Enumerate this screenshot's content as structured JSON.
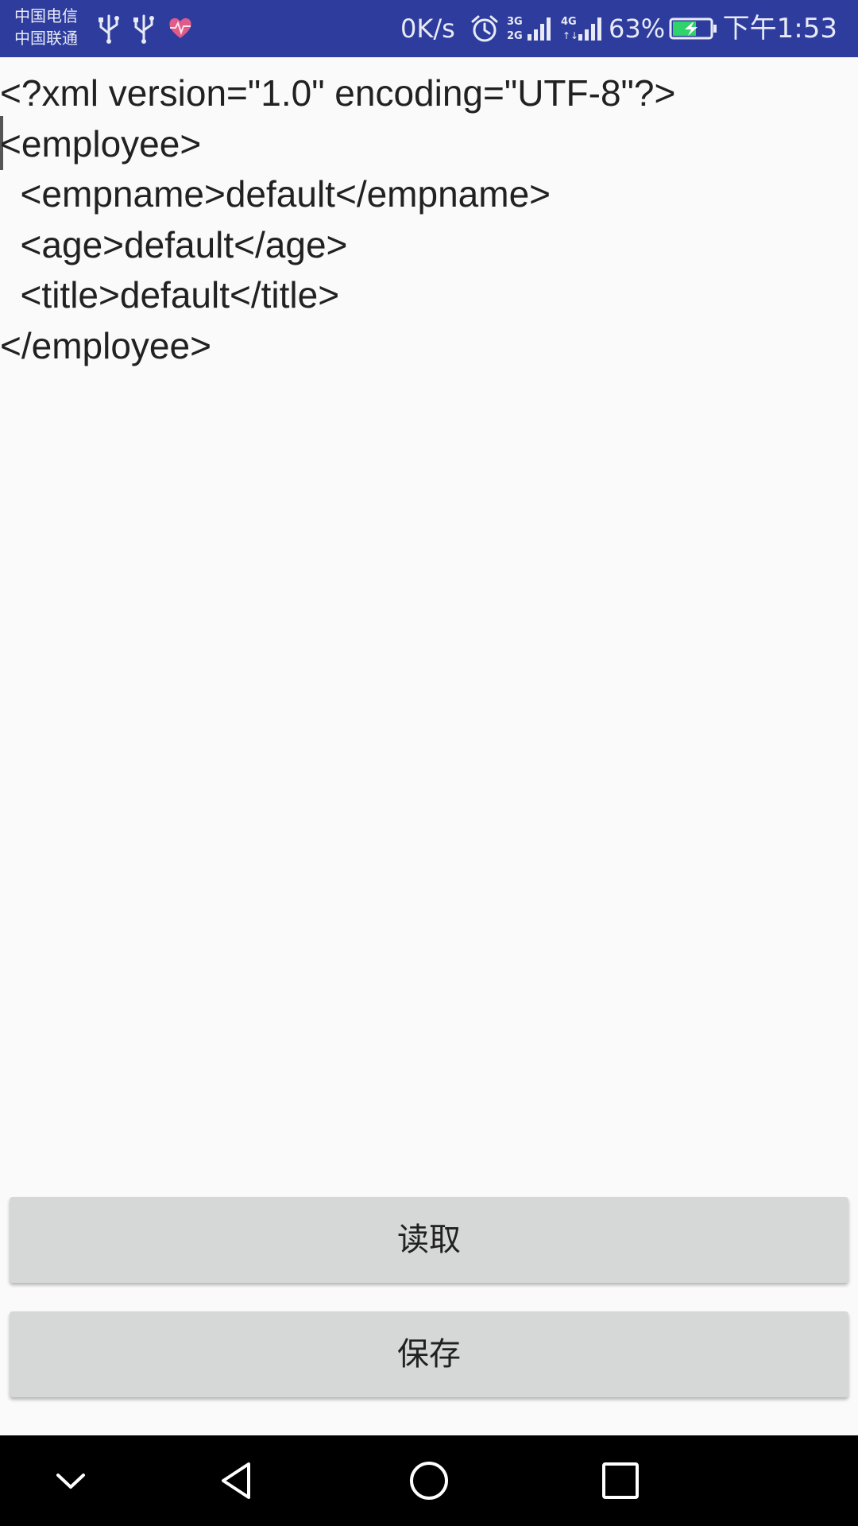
{
  "status_bar": {
    "carrier_1": "中国电信",
    "carrier_2": "中国联通",
    "net_speed": "0K/s",
    "battery_percent": "63%",
    "battery_level": 0.63,
    "time": "下午1:53",
    "bg_color": "#2e3d9d",
    "signal_1_badge": "3G 2G",
    "signal_2_badge": "4G",
    "icons": [
      "usb-icon",
      "usb-icon",
      "health-heart-icon",
      "alarm-clock-icon",
      "signal-icon",
      "signal-icon",
      "battery-charging-icon"
    ]
  },
  "editor": {
    "text": "<?xml version=\"1.0\" encoding=\"UTF-8\"?>\n<employee>\n  <empname>default</empname>\n  <age>default</age>\n  <title>default</title>\n</employee>"
  },
  "buttons": {
    "read_label": "读取",
    "save_label": "保存"
  },
  "nav_bar": {
    "icons": [
      "chevron-down-icon",
      "back-triangle-icon",
      "home-circle-icon",
      "recent-apps-square-icon"
    ]
  }
}
